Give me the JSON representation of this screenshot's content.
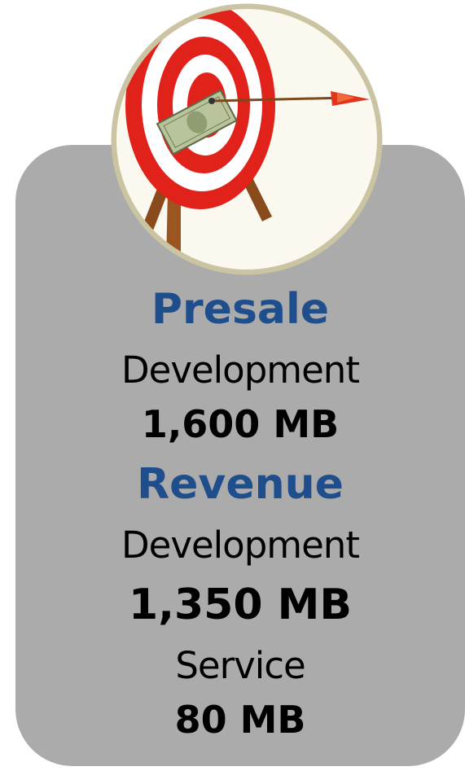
{
  "colors": {
    "card_background": "#ababab",
    "heading_color": "#1f4e8c",
    "text_color": "#000000",
    "badge_border": "#c8c2a0"
  },
  "badge": {
    "icon": "target-arrow-money-icon"
  },
  "presale": {
    "heading": "Presale",
    "label": "Development",
    "value": "1,600 MB"
  },
  "revenue": {
    "heading": "Revenue",
    "development_label": "Development",
    "development_value": "1,350 MB",
    "service_label": "Service",
    "service_value": "80 MB"
  }
}
